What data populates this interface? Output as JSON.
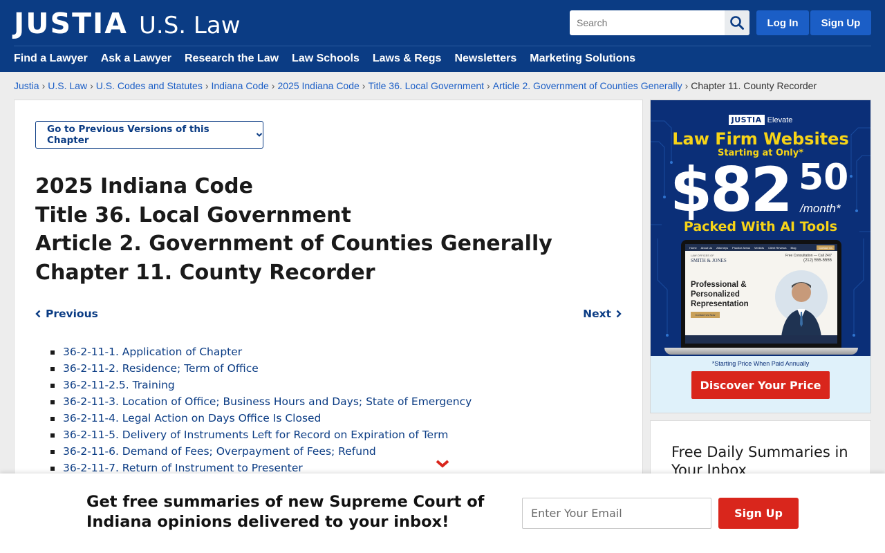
{
  "header": {
    "logo_main": "JUSTIA",
    "logo_sub": "U.S. Law",
    "search_placeholder": "Search",
    "login_label": "Log In",
    "signup_label": "Sign Up",
    "nav": [
      "Find a Lawyer",
      "Ask a Lawyer",
      "Research the Law",
      "Law Schools",
      "Laws & Regs",
      "Newsletters",
      "Marketing Solutions"
    ]
  },
  "breadcrumb": {
    "links": [
      "Justia",
      "U.S. Law",
      "U.S. Codes and Statutes",
      "Indiana Code",
      "2025 Indiana Code",
      "Title 36. Local Government",
      "Article 2. Government of Counties Generally"
    ],
    "separator": "›",
    "current": "Chapter 11. County Recorder"
  },
  "main": {
    "prev_versions_label": "Go to Previous Versions of this Chapter",
    "titles": [
      "2025 Indiana Code",
      "Title 36. Local Government",
      "Article 2. Government of Counties Generally",
      "Chapter 11. County Recorder"
    ],
    "previous_label": "Previous",
    "next_label": "Next",
    "sections": [
      "36-2-11-1. Application of Chapter",
      "36-2-11-2. Residence; Term of Office",
      "36-2-11-2.5. Training",
      "36-2-11-3. Location of Office; Business Hours and Days; State of Emergency",
      "36-2-11-4. Legal Action on Days Office Is Closed",
      "36-2-11-5. Delivery of Instruments Left for Record on Expiration of Term",
      "36-2-11-6. Demand of Fees; Overpayment of Fees; Refund",
      "36-2-11-7. Return of Instrument to Presenter"
    ]
  },
  "ad": {
    "brand": "JUSTIA",
    "brand_sub": "Elevate",
    "headline": "Law Firm Websites",
    "subhead": "Starting at Only*",
    "price_dollars": "$82",
    "price_cents": "50",
    "per_month": "/month*",
    "tagline": "Packed With AI Tools",
    "mock_nav": [
      "Home",
      "About Us",
      "Attorneys",
      "Practice Areas",
      "Verdicts",
      "Client Reviews",
      "Blog",
      "Contact Us"
    ],
    "mock_firm_small": "LAW OFFICES OF",
    "mock_firm": "SMITH & JONES",
    "mock_phone_label": "Free Consultation — Call 24/7",
    "mock_phone": "(212) 555-5555",
    "mock_tagline": "Professional & Personalized Representation",
    "mock_button": "Contact Us Now",
    "note": "*Starting Price When Paid Annually",
    "cta": "Discover Your Price",
    "colors": {
      "navy": "#0b2f78",
      "yellow": "#f7d417",
      "red": "#d9261c"
    }
  },
  "sidebar": {
    "summaries_title": "Free Daily Summaries in Your Inbox"
  },
  "sticky": {
    "text_line1": "Get free summaries of new Supreme Court of",
    "text_line2": "Indiana opinions delivered to your inbox!",
    "email_placeholder": "Enter Your Email",
    "signup_label": "Sign Up"
  },
  "icons": {
    "search": "search-icon",
    "chevron_down": "chevron-down-icon",
    "chevron_left": "chevron-left-icon",
    "chevron_right": "chevron-right-icon",
    "collapse": "chevron-down-icon"
  },
  "colors": {
    "header_bg": "#0b3c84",
    "link": "#1b5ec6",
    "dark_link": "#0b3c84",
    "button_blue": "#1b5ec6",
    "accent_red": "#d9261c",
    "page_bg": "#ededed"
  }
}
